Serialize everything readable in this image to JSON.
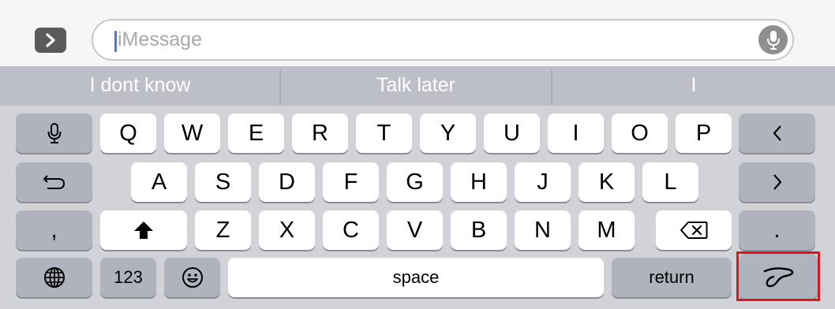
{
  "message_bar": {
    "placeholder": "iMessage"
  },
  "predictive": {
    "suggestions": [
      "I dont know",
      "Talk later",
      "I"
    ]
  },
  "keyboard": {
    "row1": [
      "Q",
      "W",
      "E",
      "R",
      "T",
      "Y",
      "U",
      "I",
      "O",
      "P"
    ],
    "row2": [
      "A",
      "S",
      "D",
      "F",
      "G",
      "H",
      "J",
      "K",
      "L"
    ],
    "row3": [
      "Z",
      "X",
      "C",
      "V",
      "B",
      "N",
      "M"
    ],
    "comma_label": ",",
    "period_label": ".",
    "numbers_label": "123",
    "space_label": "space",
    "return_label": "return",
    "icons": {
      "dictation": "microphone-icon",
      "undo": "undo-arrow-icon",
      "cursor_left": "chevron-left-icon",
      "cursor_right": "chevron-right-icon",
      "shift": "shift-arrow-icon",
      "delete": "backspace-icon",
      "globe": "globe-icon",
      "emoji": "emoji-icon",
      "handwriting": "handwriting-scribble-icon"
    },
    "highlight_color": "#e3131d"
  }
}
